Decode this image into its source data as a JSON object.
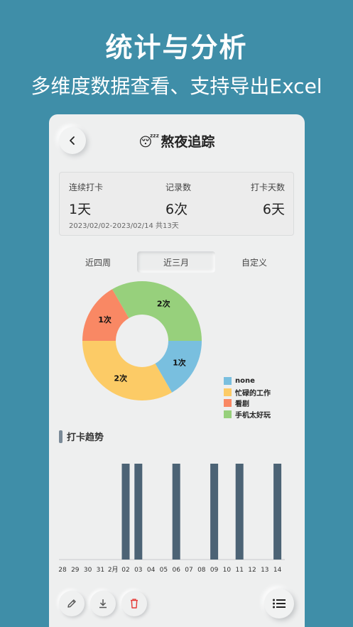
{
  "promo": {
    "title": "统计与分析",
    "subtitle": "多维度数据查看、支持导出Excel"
  },
  "header": {
    "emoji": "😴",
    "title": "熬夜追踪"
  },
  "stats": {
    "streak_label": "连续打卡",
    "streak_value": "1天",
    "records_label": "记录数",
    "records_value": "6次",
    "days_label": "打卡天数",
    "days_value": "6天",
    "range": "2023/02/02-2023/02/14 共13天"
  },
  "tabs": [
    {
      "label": "近四周",
      "active": false
    },
    {
      "label": "近三月",
      "active": true
    },
    {
      "label": "自定义",
      "active": false
    }
  ],
  "colors": {
    "none": "#79bfdf",
    "busy": "#fccb66",
    "drama": "#f98864",
    "phone": "#97d07c",
    "bar": "#4c6375"
  },
  "pie": {
    "slices": [
      {
        "name": "none",
        "value": 1,
        "label": "1次",
        "color": "#79bfdf"
      },
      {
        "name": "忙碌的工作",
        "value": 2,
        "label": "2次",
        "color": "#fccb66"
      },
      {
        "name": "看剧",
        "value": 1,
        "label": "1次",
        "color": "#f98864"
      },
      {
        "name": "手机太好玩",
        "value": 2,
        "label": "2次",
        "color": "#97d07c"
      }
    ]
  },
  "legend": [
    {
      "label": "none",
      "color": "#79bfdf"
    },
    {
      "label": "忙碌的工作",
      "color": "#fccb66"
    },
    {
      "label": "看剧",
      "color": "#f98864"
    },
    {
      "label": "手机太好玩",
      "color": "#97d07c"
    }
  ],
  "trend": {
    "title": "打卡趋势"
  },
  "chart_data": {
    "type": "bar",
    "categories": [
      "28",
      "29",
      "30",
      "31",
      "2月",
      "02",
      "03",
      "04",
      "05",
      "06",
      "07",
      "08",
      "09",
      "10",
      "11",
      "12",
      "13",
      "14"
    ],
    "values": [
      0,
      0,
      0,
      0,
      0,
      1,
      1,
      0,
      0,
      1,
      0,
      0,
      1,
      0,
      1,
      0,
      0,
      1
    ],
    "ylim": [
      0,
      1
    ],
    "grid": false
  },
  "toolbar": {
    "edit_icon": "pencil-icon",
    "export_icon": "download-icon",
    "delete_icon": "trash-icon",
    "list_icon": "list-icon"
  }
}
